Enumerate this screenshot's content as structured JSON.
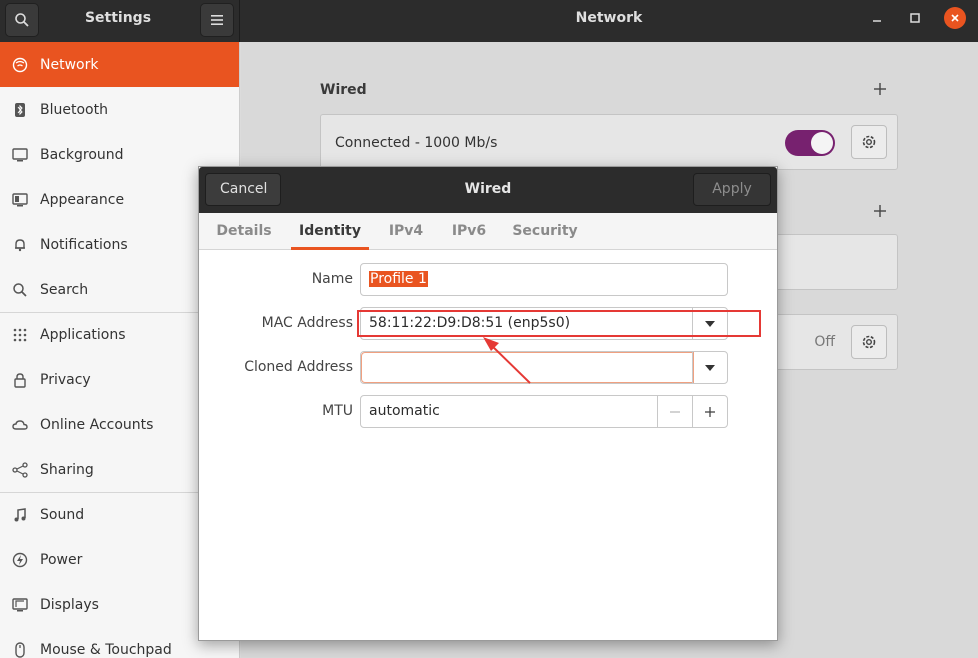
{
  "app": {
    "title": "Settings",
    "page_title": "Network"
  },
  "sidebar": {
    "items": [
      {
        "label": "Network",
        "icon": "network-icon"
      },
      {
        "label": "Bluetooth",
        "icon": "bluetooth-icon"
      },
      {
        "label": "Background",
        "icon": "background-icon"
      },
      {
        "label": "Appearance",
        "icon": "appearance-icon"
      },
      {
        "label": "Notifications",
        "icon": "bell-icon"
      },
      {
        "label": "Search",
        "icon": "search-icon"
      },
      {
        "label": "Applications",
        "icon": "grid-icon"
      },
      {
        "label": "Privacy",
        "icon": "lock-icon"
      },
      {
        "label": "Online Accounts",
        "icon": "cloud-icon"
      },
      {
        "label": "Sharing",
        "icon": "share-icon"
      },
      {
        "label": "Sound",
        "icon": "music-note-icon"
      },
      {
        "label": "Power",
        "icon": "power-icon"
      },
      {
        "label": "Displays",
        "icon": "display-icon"
      },
      {
        "label": "Mouse & Touchpad",
        "icon": "mouse-icon"
      }
    ]
  },
  "main": {
    "wired_title": "Wired",
    "connection_status": "Connected - 1000 Mb/s",
    "vpn_state": "Off"
  },
  "dialog": {
    "title": "Wired",
    "cancel_label": "Cancel",
    "apply_label": "Apply",
    "tabs": [
      "Details",
      "Identity",
      "IPv4",
      "IPv6",
      "Security"
    ],
    "active_tab": "Identity",
    "fields": {
      "name_label": "Name",
      "name_value": "Profile 1",
      "mac_label": "MAC Address",
      "mac_value": "58:11:22:D9:D8:51 (enp5s0)",
      "cloned_label": "Cloned Address",
      "cloned_value": "",
      "mtu_label": "MTU",
      "mtu_value": "automatic"
    }
  },
  "colors": {
    "accent": "#e95420",
    "toggle_on": "#77216f",
    "annotation": "#e53935"
  }
}
